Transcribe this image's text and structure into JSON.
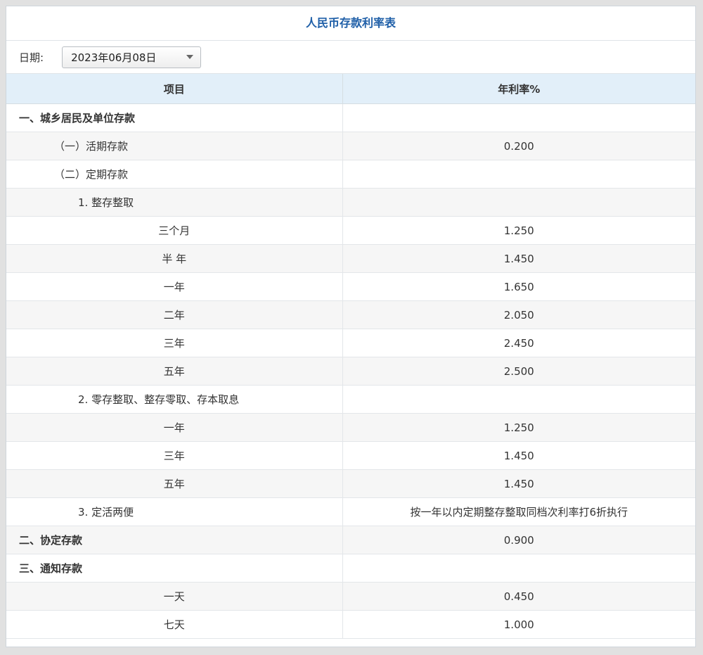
{
  "title": "人民币存款利率表",
  "filter": {
    "label": "日期:",
    "date_value": "2023年06月08日"
  },
  "table": {
    "headers": [
      "项目",
      "年利率%"
    ],
    "rows": [
      {
        "item": "一、城乡居民及单位存款",
        "rate": ""
      },
      {
        "item": "（一）活期存款",
        "rate": "0.200"
      },
      {
        "item": "（二）定期存款",
        "rate": ""
      },
      {
        "item": "1. 整存整取",
        "rate": ""
      },
      {
        "item": "三个月",
        "rate": "1.250"
      },
      {
        "item": "半 年",
        "rate": "1.450"
      },
      {
        "item": "一年",
        "rate": "1.650"
      },
      {
        "item": "二年",
        "rate": "2.050"
      },
      {
        "item": "三年",
        "rate": "2.450"
      },
      {
        "item": "五年",
        "rate": "2.500"
      },
      {
        "item": "2. 零存整取、整存零取、存本取息",
        "rate": ""
      },
      {
        "item": "一年",
        "rate": "1.250"
      },
      {
        "item": "三年",
        "rate": "1.450"
      },
      {
        "item": "五年",
        "rate": "1.450"
      },
      {
        "item": "3. 定活两便",
        "rate": "按一年以内定期整存整取同档次利率打6折执行"
      },
      {
        "item": "二、协定存款",
        "rate": "0.900"
      },
      {
        "item": "三、通知存款",
        "rate": ""
      },
      {
        "item": "一天",
        "rate": "0.450"
      },
      {
        "item": "七天",
        "rate": "1.000"
      }
    ]
  }
}
